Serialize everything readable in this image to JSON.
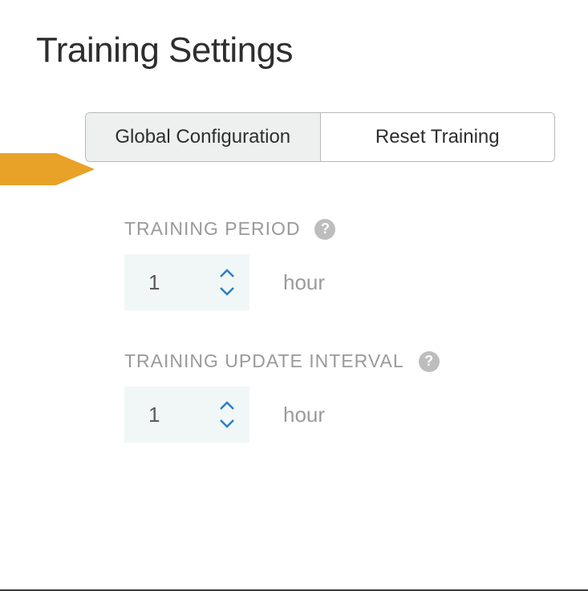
{
  "header": {
    "title": "Training Settings"
  },
  "tabs": {
    "global_config": "Global Configuration",
    "reset_training": "Reset Training"
  },
  "fields": {
    "training_period": {
      "label": "TRAINING PERIOD",
      "value": "1",
      "unit": "hour"
    },
    "training_update_interval": {
      "label": "TRAINING UPDATE INTERVAL",
      "value": "1",
      "unit": "hour"
    }
  },
  "help_char": "?"
}
